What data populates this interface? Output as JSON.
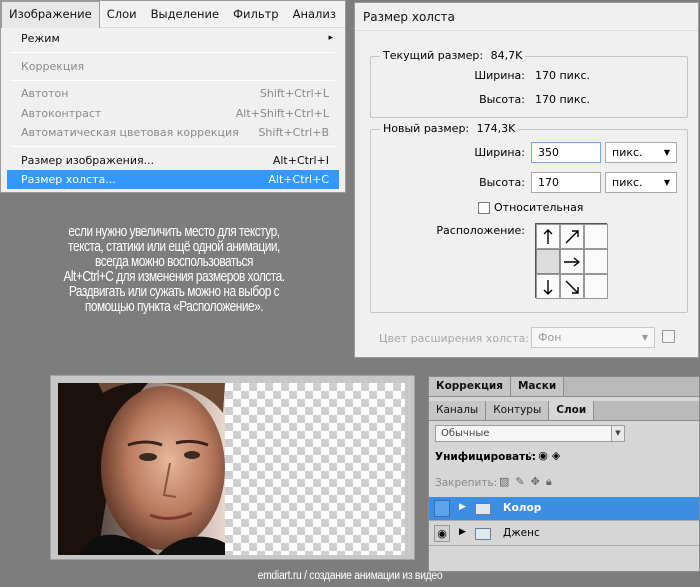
{
  "menu": {
    "bar": [
      "Изображение",
      "Слои",
      "Выделение",
      "Фильтр",
      "Анализ"
    ],
    "items": [
      {
        "label": "Режим",
        "shortcut": "",
        "submenu": true
      },
      {
        "label": "Коррекция",
        "shortcut": "",
        "submenu": true
      },
      {
        "label": "Автотон",
        "shortcut": "Shift+Ctrl+L"
      },
      {
        "label": "Автоконтраст",
        "shortcut": "Alt+Shift+Ctrl+L"
      },
      {
        "label": "Автоматическая цветовая коррекция",
        "shortcut": "Shift+Ctrl+B"
      },
      {
        "label": "Размер изображения...",
        "shortcut": "Alt+Ctrl+I"
      },
      {
        "label": "Размер холста...",
        "shortcut": "Alt+Ctrl+C"
      }
    ],
    "submenu_arrow": "▸"
  },
  "dialog": {
    "title": "Размер холста",
    "current": {
      "title": "Текущий размер:",
      "size": "84,7K",
      "width_label": "Ширина:",
      "width_value": "170 пикс.",
      "height_label": "Высота:",
      "height_value": "170 пикс."
    },
    "new": {
      "title": "Новый размер:",
      "size": "174,3K",
      "width_label": "Ширина:",
      "width_value": "350",
      "width_unit": "пикс.",
      "height_label": "Высота:",
      "height_value": "170",
      "height_unit": "пикс.",
      "relative_label": "Относительная",
      "anchor_label": "Расположение:"
    },
    "extension_label": "Цвет расширения холста:",
    "extension_value": "Фон"
  },
  "caption": [
    "если нужно увеличить место для текстур,",
    "текста, статики или ещё одной анимации,",
    "всегда можно воспользоваться",
    "Alt+Ctrl+C для изменения размеров холста.",
    "Раздвигать или сужать можно на выбор с",
    "помощью пункта «Расположение»."
  ],
  "layers_panel": {
    "top_tabs": [
      "Коррекция",
      "Маски"
    ],
    "tabs": [
      "Каналы",
      "Контуры",
      "Слои"
    ],
    "blend_mode": "Обычные",
    "unify_label": "Унифицировать:",
    "lock_label": "Закрепить:",
    "layers": [
      {
        "name": "Колор",
        "selected": true,
        "visible": false
      },
      {
        "name": "Дженс",
        "selected": false,
        "visible": true
      }
    ]
  },
  "footer": "emdiart.ru / создание анимации из видео",
  "colors": {
    "background": "#7d7d7d",
    "menu_highlight": "#3399ff",
    "layer_selected": "#3d8ee3"
  },
  "icons": {
    "anchor_arrows": [
      "arrow-up-icon",
      "arrow-up-right-icon",
      "arrow-right-icon",
      "arrow-down-icon",
      "arrow-down-right-icon"
    ],
    "dropdown": "chevron-down-icon",
    "layer_visibility": "eye-icon",
    "layer_group": "folder-icon"
  }
}
